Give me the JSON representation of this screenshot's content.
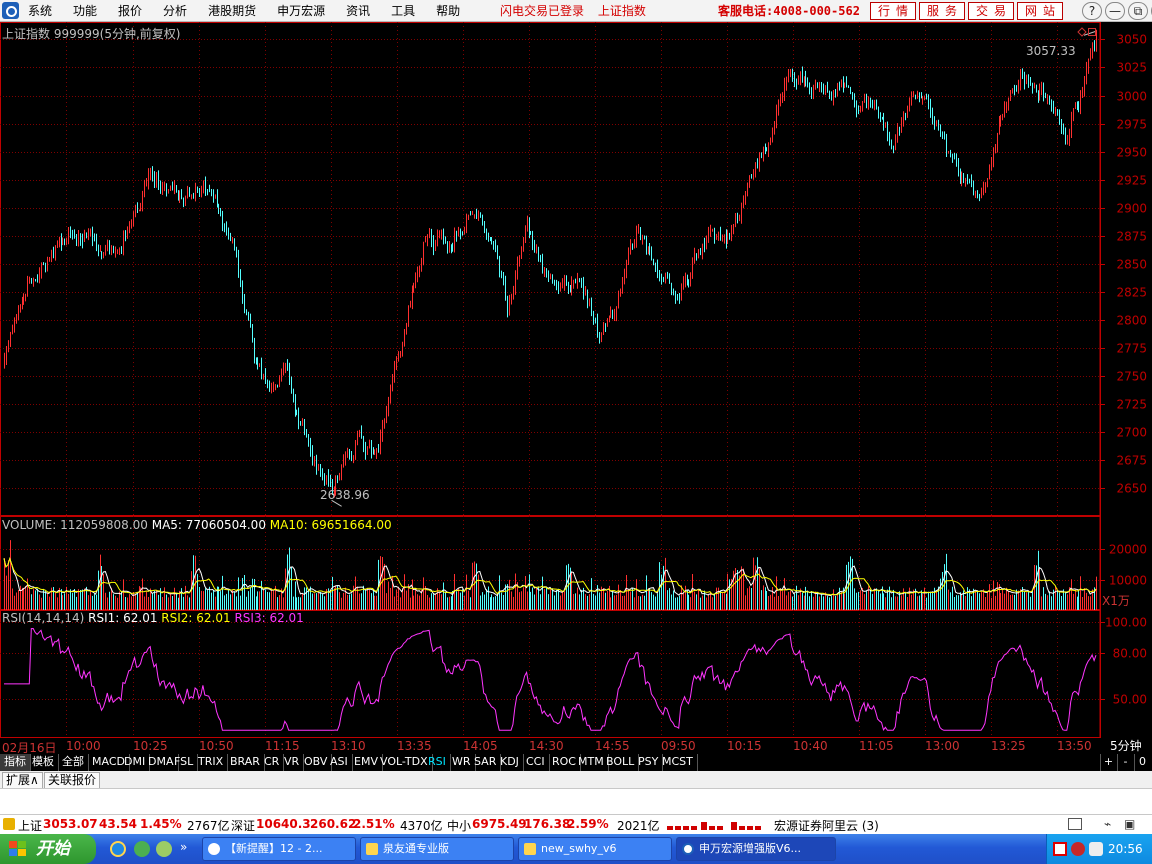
{
  "menu": [
    "系统",
    "功能",
    "报价",
    "分析",
    "港股期货",
    "申万宏源",
    "资讯",
    "工具",
    "帮助"
  ],
  "notice": [
    "闪电交易已登录",
    "上证指数"
  ],
  "hotline": "客服电话:4008-000-562",
  "top_buttons": [
    "行情",
    "服务",
    "交易",
    "网站"
  ],
  "window_buttons": [
    "?",
    "—",
    "⧉",
    "✕"
  ],
  "chart_title": {
    "name": "上证指数",
    "code": "999999",
    "period": "(5分钟,前复权)"
  },
  "price_high_label": "3057.33",
  "price_low_label": "2638.96",
  "volume_title": {
    "main": "VOLUME: 112059808.00",
    "ma5": "MA5: 77060504.00",
    "ma10": "MA10: 69651664.00"
  },
  "volume_unit": "X1万",
  "rsi_title": {
    "main": "RSI(14,14,14)",
    "rsi1": "RSI1: 62.01",
    "rsi2": "RSI2: 62.01",
    "rsi3": "RSI3: 62.01"
  },
  "period_label": "5分钟",
  "time_labels": [
    "02月16日",
    "10:00",
    "10:25",
    "10:50",
    "11:15",
    "13:10",
    "13:35",
    "14:05",
    "14:30",
    "14:55",
    "09:50",
    "10:15",
    "10:40",
    "11:05",
    "13:00",
    "13:25",
    "13:50"
  ],
  "indicator_tabs": [
    "指标",
    "模板",
    "全部",
    "MACD",
    "DMI",
    "DMA",
    "FSL",
    "TRIX",
    "BRAR",
    "CR",
    "VR",
    "OBV",
    "ASI",
    "EMV",
    "VOL-TDX",
    "RSI",
    "WR",
    "SAR",
    "KDJ",
    "CCI",
    "ROC",
    "MTM",
    "BOLL",
    "PSY",
    "MCST"
  ],
  "selected_tab": "RSI",
  "tab_controls": [
    "+",
    "-",
    "0"
  ],
  "sub_tabs": [
    "扩展∧",
    "关联报价"
  ],
  "status": {
    "sh_name": "上证",
    "sh_value": "3053.07",
    "sh_change": "43.54",
    "sh_pct": "1.45%",
    "sh_amount": "2767亿",
    "sz_name": "深证",
    "sz_value": "10640.3",
    "sz_change": "260.62",
    "sz_pct": "2.51%",
    "sz_amount": "4370亿",
    "zx_name": "中小",
    "zx_value": "6975.49",
    "zx_change": "176.38",
    "zx_pct": "2.59%",
    "zx_amount": "2021亿",
    "broker": "宏源证券阿里云 (3)"
  },
  "taskbar": {
    "start_label": "开始",
    "tasks": [
      "【新提醒】12 - 2...",
      "泉友通专业版",
      "new_swhy_v6",
      "申万宏源增强版V6..."
    ],
    "clock": "20:56"
  },
  "chart_data": [
    {
      "type": "candlestick",
      "title": "上证指数 999999(5分钟,前复权)",
      "ylim": [
        2625,
        3062
      ],
      "y_ticks": [
        2650,
        2675,
        2700,
        2725,
        2750,
        2775,
        2800,
        2825,
        2850,
        2875,
        2900,
        2925,
        2950,
        2975,
        3000,
        3025,
        3050
      ],
      "x_labels": [
        "02月16日",
        "10:00",
        "10:25",
        "10:50",
        "11:15",
        "13:10",
        "13:35",
        "14:05",
        "14:30",
        "14:55",
        "09:50",
        "10:15",
        "10:40",
        "11:05",
        "13:00",
        "13:25",
        "13:50"
      ],
      "high": 3057.33,
      "low": 2638.96,
      "grid": true,
      "trend_anchors": [
        [
          0,
          2760
        ],
        [
          10,
          2830
        ],
        [
          20,
          2850
        ],
        [
          35,
          2880
        ],
        [
          50,
          2860
        ],
        [
          60,
          2870
        ],
        [
          75,
          2925
        ],
        [
          90,
          2910
        ],
        [
          105,
          2920
        ],
        [
          118,
          2860
        ],
        [
          128,
          2770
        ],
        [
          135,
          2740
        ],
        [
          145,
          2760
        ],
        [
          150,
          2720
        ],
        [
          158,
          2680
        ],
        [
          168,
          2650
        ],
        [
          182,
          2690
        ],
        [
          192,
          2680
        ],
        [
          205,
          2790
        ],
        [
          215,
          2870
        ],
        [
          228,
          2870
        ],
        [
          240,
          2900
        ],
        [
          252,
          2860
        ],
        [
          258,
          2815
        ],
        [
          268,
          2890
        ],
        [
          278,
          2835
        ],
        [
          292,
          2840
        ],
        [
          305,
          2790
        ],
        [
          314,
          2810
        ],
        [
          324,
          2880
        ],
        [
          332,
          2850
        ],
        [
          345,
          2825
        ],
        [
          360,
          2870
        ],
        [
          372,
          2870
        ],
        [
          380,
          2920
        ],
        [
          392,
          2960
        ],
        [
          402,
          3020
        ],
        [
          416,
          3010
        ],
        [
          432,
          3000
        ],
        [
          444,
          2990
        ],
        [
          456,
          2960
        ],
        [
          468,
          3005
        ],
        [
          478,
          2980
        ],
        [
          488,
          2930
        ],
        [
          500,
          2915
        ],
        [
          512,
          2980
        ],
        [
          522,
          3020
        ],
        [
          534,
          3000
        ],
        [
          544,
          2965
        ],
        [
          552,
          3000
        ],
        [
          560,
          3050
        ]
      ]
    },
    {
      "type": "bar",
      "title": "VOLUME",
      "unit": "X1万",
      "y_ticks": [
        10000,
        20000
      ],
      "ylim": [
        0,
        25000
      ],
      "series": [
        {
          "name": "VOLUME"
        },
        {
          "name": "MA5"
        },
        {
          "name": "MA10"
        }
      ]
    },
    {
      "type": "line",
      "title": "RSI(14,14,14)",
      "y_ticks": [
        50.0,
        80.0,
        100.0
      ],
      "ylim": [
        25,
        100
      ],
      "series": [
        {
          "name": "RSI1"
        },
        {
          "name": "RSI2"
        },
        {
          "name": "RSI3"
        }
      ]
    }
  ],
  "colors": {
    "up": "#ff3030",
    "down": "#54ffff",
    "grid": "#800000",
    "axis": "#c00000",
    "ma5": "#ffffff",
    "ma10": "#ffff00",
    "rsi": "#ff36ff"
  }
}
